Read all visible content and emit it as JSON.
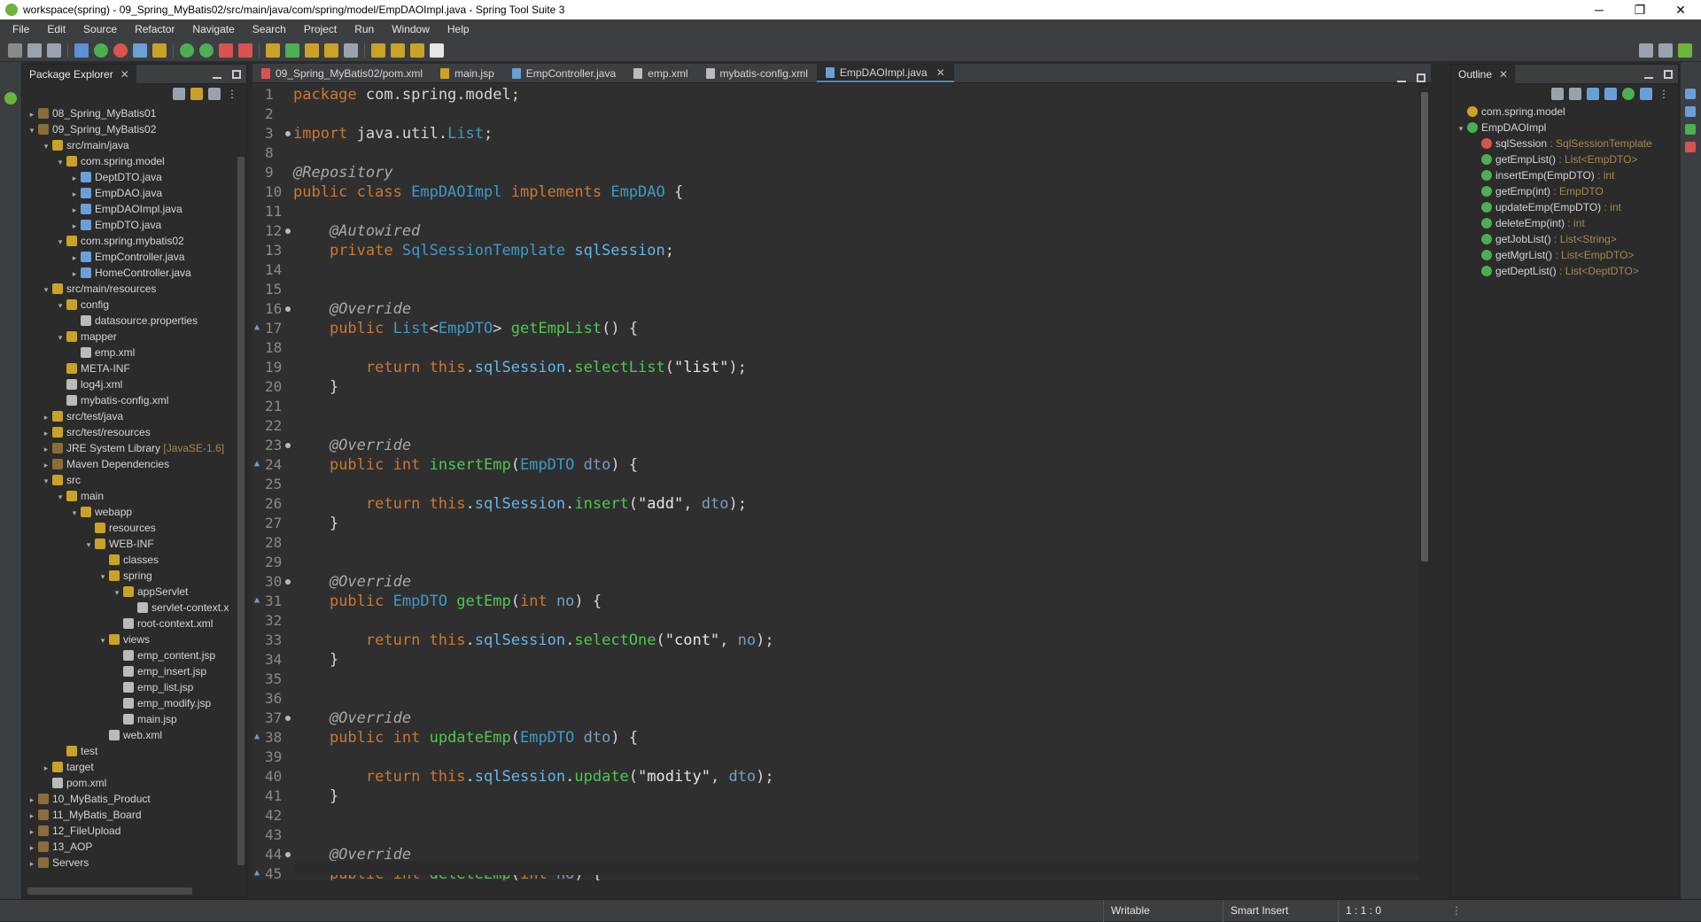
{
  "window": {
    "title": "workspace(spring) - 09_Spring_MyBatis02/src/main/java/com/spring/model/EmpDAOImpl.java - Spring Tool Suite 3",
    "minimize": "─",
    "maximize": "❐",
    "close": "✕"
  },
  "menu": [
    "File",
    "Edit",
    "Source",
    "Refactor",
    "Navigate",
    "Search",
    "Project",
    "Run",
    "Window",
    "Help"
  ],
  "package_explorer": {
    "tab": "Package Explorer",
    "items": [
      {
        "label": "08_Spring_MyBatis01",
        "extra": ""
      },
      {
        "label": "09_Spring_MyBatis02",
        "extra": ""
      },
      {
        "label": "src/main/java",
        "extra": ""
      },
      {
        "label": "com.spring.model",
        "extra": ""
      },
      {
        "label": "DeptDTO.java",
        "extra": ""
      },
      {
        "label": "EmpDAO.java",
        "extra": ""
      },
      {
        "label": "EmpDAOImpl.java",
        "extra": ""
      },
      {
        "label": "EmpDTO.java",
        "extra": ""
      },
      {
        "label": "com.spring.mybatis02",
        "extra": ""
      },
      {
        "label": "EmpController.java",
        "extra": ""
      },
      {
        "label": "HomeController.java",
        "extra": ""
      },
      {
        "label": "src/main/resources",
        "extra": ""
      },
      {
        "label": "config",
        "extra": ""
      },
      {
        "label": "datasource.properties",
        "extra": ""
      },
      {
        "label": "mapper",
        "extra": ""
      },
      {
        "label": "emp.xml",
        "extra": ""
      },
      {
        "label": "META-INF",
        "extra": ""
      },
      {
        "label": "log4j.xml",
        "extra": ""
      },
      {
        "label": "mybatis-config.xml",
        "extra": ""
      },
      {
        "label": "src/test/java",
        "extra": ""
      },
      {
        "label": "src/test/resources",
        "extra": ""
      },
      {
        "label": "JRE System Library",
        "extra": "[JavaSE-1.6]"
      },
      {
        "label": "Maven Dependencies",
        "extra": ""
      },
      {
        "label": "src",
        "extra": ""
      },
      {
        "label": "main",
        "extra": ""
      },
      {
        "label": "webapp",
        "extra": ""
      },
      {
        "label": "resources",
        "extra": ""
      },
      {
        "label": "WEB-INF",
        "extra": ""
      },
      {
        "label": "classes",
        "extra": ""
      },
      {
        "label": "spring",
        "extra": ""
      },
      {
        "label": "appServlet",
        "extra": ""
      },
      {
        "label": "servlet-context.x",
        "extra": ""
      },
      {
        "label": "root-context.xml",
        "extra": ""
      },
      {
        "label": "views",
        "extra": ""
      },
      {
        "label": "emp_content.jsp",
        "extra": ""
      },
      {
        "label": "emp_insert.jsp",
        "extra": ""
      },
      {
        "label": "emp_list.jsp",
        "extra": ""
      },
      {
        "label": "emp_modify.jsp",
        "extra": ""
      },
      {
        "label": "main.jsp",
        "extra": ""
      },
      {
        "label": "web.xml",
        "extra": ""
      },
      {
        "label": "test",
        "extra": ""
      },
      {
        "label": "target",
        "extra": ""
      },
      {
        "label": "pom.xml",
        "extra": ""
      },
      {
        "label": "10_MyBatis_Product",
        "extra": ""
      },
      {
        "label": "11_MyBatis_Board",
        "extra": ""
      },
      {
        "label": "12_FileUpload",
        "extra": ""
      },
      {
        "label": "13_AOP",
        "extra": ""
      },
      {
        "label": "Servers",
        "extra": ""
      }
    ]
  },
  "editor": {
    "tabs": [
      "09_Spring_MyBatis02/pom.xml",
      "main.jsp",
      "EmpController.java",
      "emp.xml",
      "mybatis-config.xml",
      "EmpDAOImpl.java"
    ],
    "active_tab": "EmpDAOImpl.java",
    "line_numbers": [
      "1",
      "2",
      "3",
      "8",
      "9",
      "10",
      "11",
      "12",
      "13",
      "14",
      "15",
      "16",
      "17",
      "18",
      "19",
      "20",
      "21",
      "22",
      "23",
      "24",
      "25",
      "26",
      "27",
      "28",
      "29",
      "30",
      "31",
      "32",
      "33",
      "34",
      "35",
      "36",
      "37",
      "38",
      "39",
      "40",
      "41",
      "42",
      "43",
      "44",
      "45"
    ],
    "lines": [
      "package com.spring.model;",
      "",
      "import java.util.List;",
      "",
      "@Repository",
      "public class EmpDAOImpl implements EmpDAO {",
      "",
      "    @Autowired",
      "    private SqlSessionTemplate sqlSession;",
      "",
      "",
      "    @Override",
      "    public List<EmpDTO> getEmpList() {",
      "",
      "        return this.sqlSession.selectList(\"list\");",
      "    }",
      "",
      "",
      "    @Override",
      "    public int insertEmp(EmpDTO dto) {",
      "",
      "        return this.sqlSession.insert(\"add\", dto);",
      "    }",
      "",
      "",
      "    @Override",
      "    public EmpDTO getEmp(int no) {",
      "",
      "        return this.sqlSession.selectOne(\"cont\", no);",
      "    }",
      "",
      "",
      "    @Override",
      "    public int updateEmp(EmpDTO dto) {",
      "",
      "        return this.sqlSession.update(\"modity\", dto);",
      "    }",
      "",
      "",
      "    @Override",
      "    public int deleteEmp(int no) {"
    ]
  },
  "outline": {
    "tab": "Outline",
    "items": [
      {
        "label": "com.spring.model",
        "type": ""
      },
      {
        "label": "EmpDAOImpl",
        "type": ""
      },
      {
        "label": "sqlSession",
        "type": " : SqlSessionTemplate"
      },
      {
        "label": "getEmpList()",
        "type": " : List<EmpDTO>"
      },
      {
        "label": "insertEmp(EmpDTO)",
        "type": " : int"
      },
      {
        "label": "getEmp(int)",
        "type": " : EmpDTO"
      },
      {
        "label": "updateEmp(EmpDTO)",
        "type": " : int"
      },
      {
        "label": "deleteEmp(int)",
        "type": " : int"
      },
      {
        "label": "getJobList()",
        "type": " : List<String>"
      },
      {
        "label": "getMgrList()",
        "type": " : List<EmpDTO>"
      },
      {
        "label": "getDeptList()",
        "type": " : List<DeptDTO>"
      }
    ]
  },
  "status": {
    "writable": "Writable",
    "insert_mode": "Smart Insert",
    "position": "1 : 1 : 0"
  },
  "colors": {
    "keyword": "#cc7832",
    "type": "#3d9bc7",
    "method": "#4ec94e",
    "field": "#66b6e6",
    "background": "#2f2f2f"
  }
}
